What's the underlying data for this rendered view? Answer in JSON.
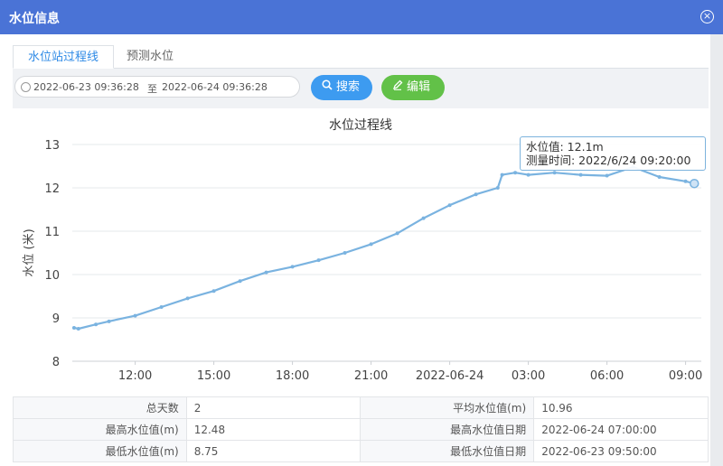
{
  "window": {
    "title": "水位信息",
    "close_icon": "close-circle-icon"
  },
  "tabs": [
    {
      "label": "水位站过程线",
      "active": true
    },
    {
      "label": "预测水位",
      "active": false
    }
  ],
  "toolbar": {
    "start": "2022-06-23  09:36:28",
    "separator": "至",
    "end": "2022-06-24  09:36:28",
    "search_label": "搜索",
    "edit_label": "编辑",
    "search_color": "#3d9bf0",
    "edit_color": "#62c148"
  },
  "chart_data": {
    "type": "line",
    "title": "水位过程线",
    "ylabel": "水位 (米)",
    "xlabel": "",
    "ylim": [
      8,
      13
    ],
    "yticks": [
      8,
      9,
      10,
      11,
      12,
      13
    ],
    "xticks": [
      {
        "t": "2022-06-23 12:00",
        "label": "12:00"
      },
      {
        "t": "2022-06-23 15:00",
        "label": "15:00"
      },
      {
        "t": "2022-06-23 18:00",
        "label": "18:00"
      },
      {
        "t": "2022-06-23 21:00",
        "label": "21:00"
      },
      {
        "t": "2022-06-24 00:00",
        "label": "2022-06-24"
      },
      {
        "t": "2022-06-24 03:00",
        "label": "03:00"
      },
      {
        "t": "2022-06-24 06:00",
        "label": "06:00"
      },
      {
        "t": "2022-06-24 09:00",
        "label": "09:00"
      }
    ],
    "xrange": [
      "2022-06-23 09:36",
      "2022-06-24 09:36"
    ],
    "grid": true,
    "line_color": "#7ab3e0",
    "series": [
      {
        "points": [
          [
            "2022-06-23 09:40",
            8.77
          ],
          [
            "2022-06-23 09:50",
            8.75
          ],
          [
            "2022-06-23 10:30",
            8.85
          ],
          [
            "2022-06-23 11:00",
            8.92
          ],
          [
            "2022-06-23 12:00",
            9.05
          ],
          [
            "2022-06-23 13:00",
            9.25
          ],
          [
            "2022-06-23 14:00",
            9.45
          ],
          [
            "2022-06-23 15:00",
            9.62
          ],
          [
            "2022-06-23 16:00",
            9.85
          ],
          [
            "2022-06-23 17:00",
            10.05
          ],
          [
            "2022-06-23 18:00",
            10.18
          ],
          [
            "2022-06-23 19:00",
            10.33
          ],
          [
            "2022-06-23 20:00",
            10.5
          ],
          [
            "2022-06-23 21:00",
            10.7
          ],
          [
            "2022-06-23 22:00",
            10.95
          ],
          [
            "2022-06-23 23:00",
            11.3
          ],
          [
            "2022-06-24 00:00",
            11.6
          ],
          [
            "2022-06-24 01:00",
            11.85
          ],
          [
            "2022-06-24 01:50",
            12.0
          ],
          [
            "2022-06-24 02:00",
            12.3
          ],
          [
            "2022-06-24 02:30",
            12.35
          ],
          [
            "2022-06-24 03:00",
            12.3
          ],
          [
            "2022-06-24 04:00",
            12.35
          ],
          [
            "2022-06-24 05:00",
            12.3
          ],
          [
            "2022-06-24 06:00",
            12.28
          ],
          [
            "2022-06-24 07:00",
            12.48
          ],
          [
            "2022-06-24 08:00",
            12.25
          ],
          [
            "2022-06-24 09:00",
            12.15
          ],
          [
            "2022-06-24 09:20",
            12.1
          ]
        ]
      }
    ],
    "tooltip": {
      "value_label": "水位值: 12.1m",
      "time_label": "测量时间: 2022/6/24 09:20:00",
      "t": "2022-06-24 09:20",
      "y": 12.1
    }
  },
  "stats": {
    "rows": [
      {
        "l1": "总天数",
        "v1": "2",
        "l2": "平均水位值(m)",
        "v2": "10.96"
      },
      {
        "l1": "最高水位值(m)",
        "v1": "12.48",
        "l2": "最高水位值日期",
        "v2": "2022-06-24 07:00:00"
      },
      {
        "l1": "最低水位值(m)",
        "v1": "8.75",
        "l2": "最低水位值日期",
        "v2": "2022-06-23 09:50:00"
      }
    ]
  }
}
